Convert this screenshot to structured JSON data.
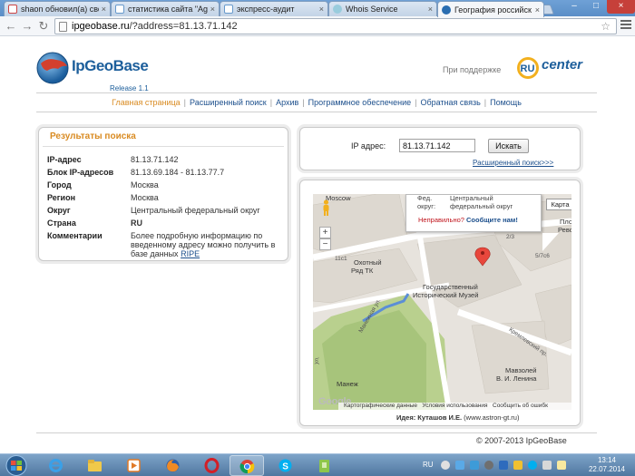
{
  "browser": {
    "tabs": [
      {
        "label": "shaon обновил(а) свс",
        "active": false
      },
      {
        "label": "статистика сайта \"Agu",
        "active": false
      },
      {
        "label": "экспресс-аудит",
        "active": false
      },
      {
        "label": "Whois Service",
        "active": false
      },
      {
        "label": "География российск",
        "active": true
      }
    ],
    "url_host": "ipgeobase.ru",
    "url_path": "/?address=81.13.71.142",
    "tab_close_glyph": "×",
    "win_min": "–",
    "win_max": "□",
    "win_close": "×"
  },
  "header": {
    "logo_text": "IpGeoBase",
    "release": "Release 1.1",
    "support_text": "При поддержке",
    "partner_logo": "RUcenter"
  },
  "nav": [
    {
      "label": "Главная страница",
      "current": true
    },
    {
      "label": "Расширенный поиск",
      "current": false
    },
    {
      "label": "Архив",
      "current": false
    },
    {
      "label": "Программное обеспечение",
      "current": false
    },
    {
      "label": "Обратная связь",
      "current": false
    },
    {
      "label": "Помощь",
      "current": false
    }
  ],
  "nav_separator": "|",
  "results": {
    "title": "Результаты поиска",
    "rows": [
      {
        "label": "IP-адрес",
        "value": "81.13.71.142"
      },
      {
        "label": "Блок IP-адресов",
        "value": "81.13.69.184 - 81.13.77.7"
      },
      {
        "label": "Город",
        "value": "Москва"
      },
      {
        "label": "Регион",
        "value": "Москва"
      },
      {
        "label": "Округ",
        "value": "Центральный федеральный округ"
      },
      {
        "label": "Страна",
        "value": "RU"
      }
    ],
    "comment_label": "Комментарии",
    "comment_text": "Более подробную информацию по введенному адресу можно получить в базе данных",
    "comment_link": "RIPE"
  },
  "search": {
    "label": "IP адрес:",
    "value": "81.13.71.142",
    "button": "Искать",
    "advanced_link": "Расширенный поиск>>>"
  },
  "map": {
    "info_window": {
      "district_label": "Фед.",
      "district_label2": "округ:",
      "district_value": "Центральный",
      "district_value2": "федеральный округ",
      "wrong": "Неправильно?",
      "report": "Сообщите нам!"
    },
    "type_button": "Карта",
    "zoom_in": "+",
    "zoom_out": "−",
    "labels": {
      "moscow": "Moscow",
      "okhotny": "Охотный",
      "ryad": "Ряд ТК",
      "museum1": "Государственный",
      "museum2": "Исторический Музей",
      "manezh": "Манеж",
      "mausoleum1": "Мавзолей",
      "mausoleum2": "В. И. Ленина",
      "plo": "Пло",
      "revo": "Рево",
      "kremlin_street": "Кремлевский пр.",
      "manezh_street": "Манежная ул.",
      "num1": "11с1",
      "num2": "2/3",
      "num3": "5/7c6",
      "ul": "ул."
    },
    "google": "Google",
    "footer_data": "Картографические данные",
    "footer_terms": "Условия использования",
    "footer_error": "Сообщить об ошибк"
  },
  "credit": {
    "prefix": "Идея:",
    "author": "Куташов И.Е.",
    "site": "(www.astron-gt.ru)"
  },
  "copyright": "© 2007-2013 IpGeoBase",
  "taskbar": {
    "lang": "RU",
    "time": "13:14",
    "date": "22.07.2014"
  }
}
